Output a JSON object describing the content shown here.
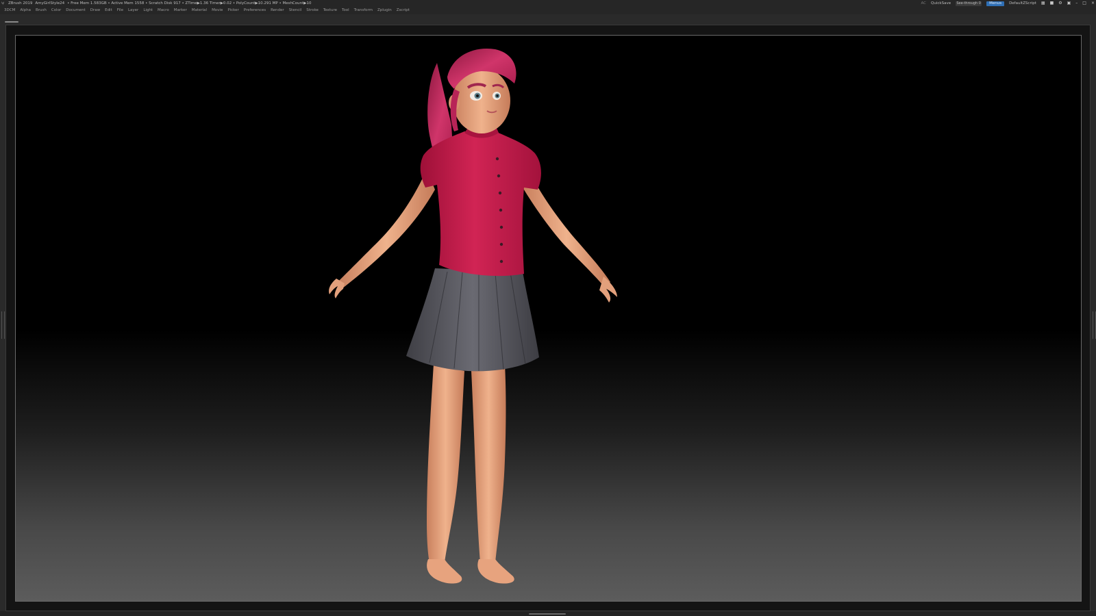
{
  "titlebar": {
    "app_name": "ZBrush 2019",
    "project_name": "AmyGirlStyle24",
    "stats": "• Free Mem 1.583GB • Active Mem 1558 • Scratch Disk 917 • ZTime▶1.36 Timer▶0.02 • PolyCount▶10.291 MP • MeshCount▶10",
    "ac_label": "AC",
    "quicksave_label": "QuickSave",
    "see_through_label": "See-through",
    "see_through_value": "0",
    "see_through_level": 0.0,
    "menus_label": "Menus",
    "script_label": "DefaultZScript"
  },
  "menubar": {
    "items": [
      "3DCM",
      "Alpha",
      "Brush",
      "Color",
      "Document",
      "Draw",
      "Edit",
      "File",
      "Layer",
      "Light",
      "Macro",
      "Marker",
      "Material",
      "Movie",
      "Picker",
      "Preferences",
      "Render",
      "Stencil",
      "Stroke",
      "Texture",
      "Tool",
      "Transform",
      "Zplugin",
      "Zscript"
    ]
  },
  "icons": {
    "app_logo": "zbrush-logo-icon",
    "window_controls": [
      "layout-icon",
      "palette-icon",
      "brush-settings-icon",
      "lock-icon",
      "minimize-icon",
      "maximize-icon",
      "close-icon"
    ]
  },
  "colors": {
    "shirt": "#c41a4a",
    "hair": "#c2275a",
    "skin": "#e9a57f",
    "skirt": "#55555b",
    "accent_blue": "#2f6fb5",
    "accent_orange": "#e9a000"
  }
}
